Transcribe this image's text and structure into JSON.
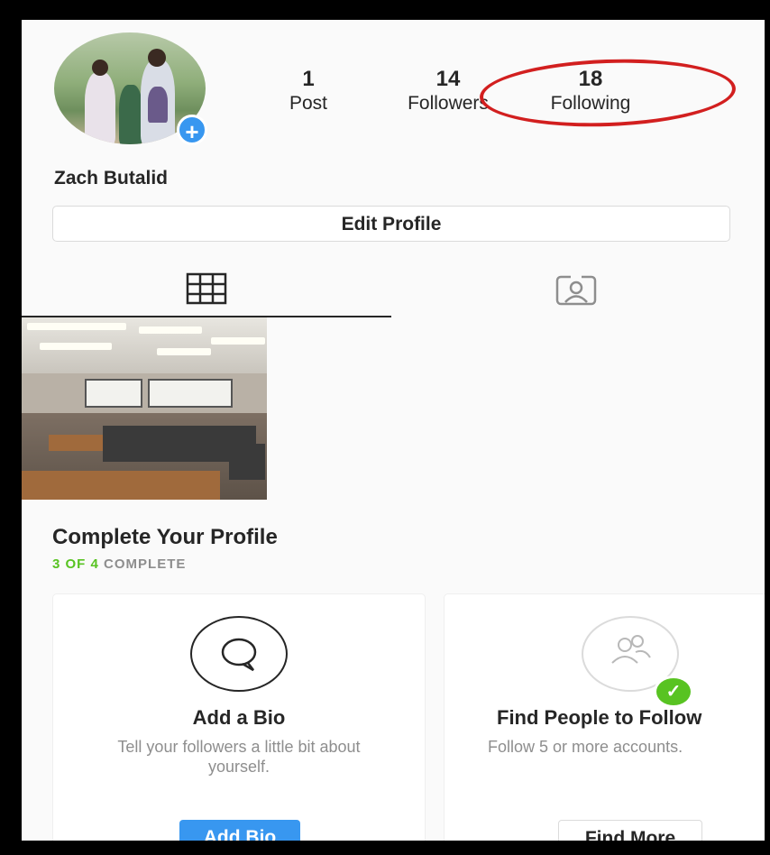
{
  "profile": {
    "username": "Zach Butalid",
    "add_badge": "+",
    "stats": [
      {
        "num": "1",
        "label": "Post"
      },
      {
        "num": "14",
        "label": "Followers"
      },
      {
        "num": "18",
        "label": "Following"
      }
    ],
    "edit_button": "Edit Profile"
  },
  "tabs": {
    "grid_icon": "grid-icon",
    "tagged_icon": "tagged-person-icon"
  },
  "complete_profile": {
    "title": "Complete Your Profile",
    "progress_done": "3 OF 4",
    "progress_rest": " COMPLETE",
    "cards": [
      {
        "icon": "speech-bubble-icon",
        "title": "Add a Bio",
        "desc": "Tell your followers a little bit about yourself.",
        "button": "Add Bio"
      },
      {
        "icon": "people-icon",
        "title": "Find People to Follow",
        "desc": "Follow 5 or more accounts.",
        "button": "Find More",
        "check": "✓"
      }
    ]
  },
  "colors": {
    "accent": "#3897f0",
    "complete_green": "#58c322",
    "annotation_red": "#d21f1f"
  }
}
